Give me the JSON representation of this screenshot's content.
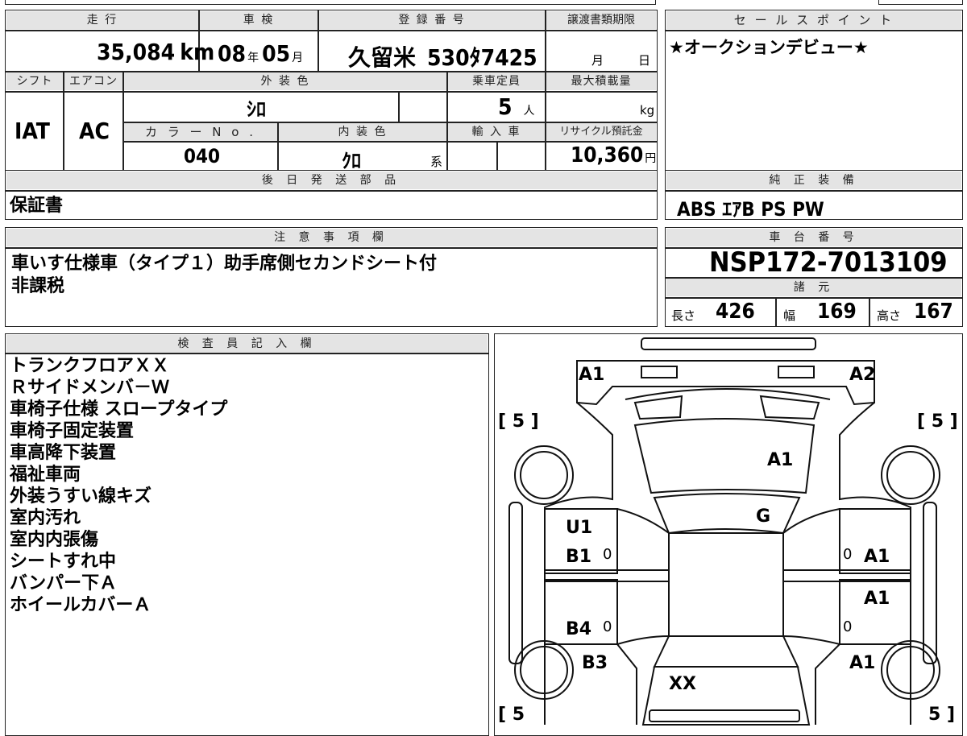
{
  "header": {
    "mileage_label": "走 行",
    "inspection_label": "車 検",
    "registration_label": "登 録 番 号",
    "transfer_label": "譲渡書類期限",
    "sales_label": "セ ー ル ス ポ イ ン ト"
  },
  "vehicle": {
    "mileage": "35,084",
    "mileage_unit": "km",
    "inspection_year": "08",
    "inspection_year_unit": "年",
    "inspection_month": "05",
    "inspection_month_unit": "月",
    "registration_city": "久留米",
    "registration_number": "530ﾀ7425",
    "transfer_month": "月",
    "transfer_day": "日",
    "shift_label": "シフト",
    "shift": "IAT",
    "ac_label": "エアコン",
    "ac": "AC",
    "exterior_color_label": "外 装 色",
    "exterior_color": "ｼﾛ",
    "capacity_label": "乗車定員",
    "capacity": "5",
    "capacity_unit": "人",
    "max_load_label": "最大積載量",
    "max_load_unit": "kg",
    "color_no_label": "カ ラ ー N o .",
    "color_no": "040",
    "interior_color_label": "内 装 色",
    "interior_color": "ｸﾛ",
    "interior_color_unit": "系",
    "import_label": "輸 入 車",
    "recycle_label": "リサイクル預託金",
    "recycle_fee": "10,360",
    "recycle_unit": "円"
  },
  "sales_point": "★オークションデビュー★",
  "later_parts": {
    "label": "後 日 発 送 部 品",
    "value": "保証書"
  },
  "equipment": {
    "label": "純 正 装 備",
    "value": "ABS ｴｱB PS PW"
  },
  "notes": {
    "label": "注 意 事 項 欄",
    "lines": [
      "車いす仕様車（タイプ１）助手席側セカンドシート付",
      "非課税"
    ]
  },
  "chassis": {
    "label": "車 台 番 号",
    "value": "NSP172-7013109"
  },
  "specs": {
    "label": "諸 元",
    "length_label": "長さ",
    "length": "426",
    "width_label": "幅",
    "width": "169",
    "height_label": "高さ",
    "height": "167"
  },
  "inspector": {
    "label": "検 査 員 記 入 欄",
    "lines": [
      "トランクフロアＸＸ",
      "Ｒサイドメンバ－Ｗ",
      "車椅子仕様 スロープタイプ",
      "車椅子固定装置",
      "車高降下装置",
      "福祉車両",
      "外装うすい線キズ",
      "室内汚れ",
      "室内内張傷",
      "シートすれ中",
      "バンパー下Ａ",
      "ホイールカバーＡ"
    ]
  },
  "diagram": {
    "tire_left_front": "[ 5 ]",
    "tire_right_front": "[ 5 ]",
    "tire_left_rear": "[ 5",
    "tire_right_rear": "5 ]",
    "front_left": "A1",
    "front_right": "A2",
    "hood": "A1",
    "windshield": "G",
    "left_front_door_u": "U1",
    "left_front_door_b": "B1",
    "left_front_door_zero": "0",
    "left_rear_door": "B4",
    "left_rear_door_zero": "0",
    "left_rear_quarter": "B3",
    "right_front_door": "A1",
    "right_front_door_zero": "0",
    "right_rear_door": "A1",
    "right_rear_door_zero": "0",
    "right_rear_quarter": "A1",
    "trunk": "XX"
  }
}
